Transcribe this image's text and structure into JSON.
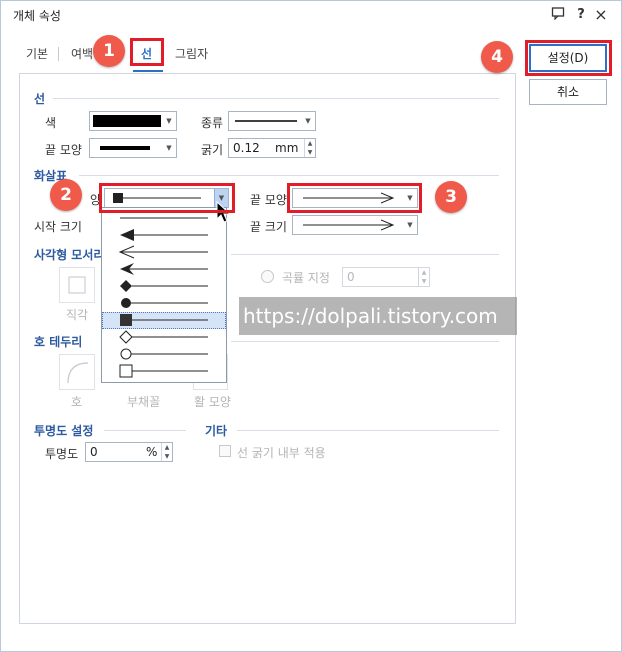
{
  "window": {
    "title": "개체 속성",
    "icons": [
      "chat-icon",
      "help-icon",
      "close-icon"
    ],
    "help_glyph": "?",
    "close_glyph": "×"
  },
  "tabs": [
    {
      "label": "기본",
      "active": false
    },
    {
      "label": "여백",
      "active": false
    },
    {
      "label": "선",
      "active": true
    },
    {
      "label": "그림자",
      "active": false
    }
  ],
  "buttons": {
    "ok": "설정(D)",
    "cancel": "취소"
  },
  "line": {
    "section": "선",
    "color_label": "색",
    "kind_label": "종류",
    "end_shape_label": "끝 모양",
    "thickness_label": "굵기",
    "thickness_value": "0.12",
    "thickness_unit": "mm"
  },
  "arrow": {
    "section": "화살표",
    "start_shape_label": "시작 모양",
    "start_shape_partial": "양",
    "start_size_label": "시작 크기",
    "end_shape_label": "끝 모양",
    "end_size_label": "끝 크기"
  },
  "rect_corner": {
    "section": "사각형 모서리",
    "right_angle": "직각",
    "curve_label": "곡률 지정",
    "curve_value": "0"
  },
  "arc_border": {
    "section": "호 테두리",
    "arc": "호",
    "sector": "부채꼴",
    "bow": "활 모양"
  },
  "transparency": {
    "section": "투명도 설정",
    "label": "투명도",
    "value": "0",
    "unit": "%"
  },
  "etc": {
    "section": "기타",
    "inner_thickness": "선 굵기 내부 적용"
  },
  "arrow_options": [
    "none",
    "arrow-filled",
    "arrow-open",
    "arrow-concave",
    "diamond-filled",
    "circle-filled",
    "square-filled",
    "diamond-open",
    "circle-open",
    "square-open"
  ],
  "selected_arrow_option": "square-filled",
  "badges": [
    "1",
    "2",
    "3",
    "4"
  ],
  "watermark": "https://dolpali.tistory.com",
  "colors": {
    "accent": "#2f6fc9",
    "highlight": "#e11d2a",
    "badge": "#ef5a4a"
  }
}
